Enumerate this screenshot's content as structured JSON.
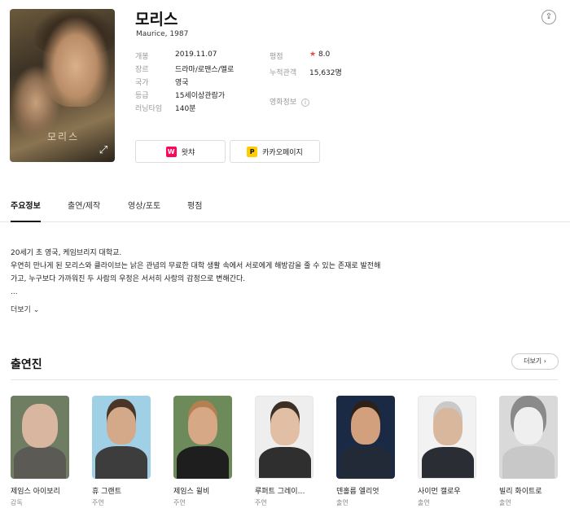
{
  "movie": {
    "title": "모리스",
    "subtitle": "Maurice, 1987",
    "poster_title": "모리스"
  },
  "info_left": [
    {
      "label": "개봉",
      "value": "2019.11.07"
    },
    {
      "label": "장르",
      "value": "드라마/로맨스/멜로"
    },
    {
      "label": "국가",
      "value": "영국"
    },
    {
      "label": "등급",
      "value": "15세이상관람가"
    },
    {
      "label": "러닝타임",
      "value": "140분"
    }
  ],
  "info_right": {
    "rating_label": "평점",
    "rating_star": "★",
    "rating_value": "8.0",
    "audience_label": "누적관객",
    "audience_value": "15,632명",
    "movie_info_label": "영화정보",
    "movie_info_badge": "i"
  },
  "ott": [
    {
      "label": "왓챠",
      "logo_text": "W",
      "logo_color": "#ff0558"
    },
    {
      "label": "카카오페이지",
      "logo_text": "P",
      "logo_color": "#ffcd00"
    }
  ],
  "tabs": [
    "주요정보",
    "출연/제작",
    "영상/포토",
    "평점"
  ],
  "synopsis": {
    "lines": [
      "20세기 초 영국, 케임브리지 대학교.",
      "우연히 만나게 된 모리스와 클라이브는 낡은 관념의 무료한 대학 생활 속에서 서로에게 해방감을 줄 수 있는 존재로 발전해",
      "가고, 누구보다 가까워진 두 사람의 우정은 서서히 사랑의 감정으로 변해간다.",
      "..."
    ],
    "more_label": "더보기"
  },
  "cast_section": {
    "title": "출연진",
    "more_label": "더보기"
  },
  "cast": [
    {
      "name": "제임스 아이보리",
      "role": "감독"
    },
    {
      "name": "휴 그랜트",
      "role": "주연"
    },
    {
      "name": "제임스 윌비",
      "role": "주연"
    },
    {
      "name": "루퍼트 그레이…",
      "role": "주연"
    },
    {
      "name": "덴홀름 엘리엇",
      "role": "출연"
    },
    {
      "name": "사이먼 캘로우",
      "role": "출연"
    },
    {
      "name": "빌리 화이트로",
      "role": "출연"
    }
  ],
  "colors": {
    "accent_star": "#e74c3c",
    "text_muted": "#999999",
    "divider": "#e5e5e5"
  }
}
